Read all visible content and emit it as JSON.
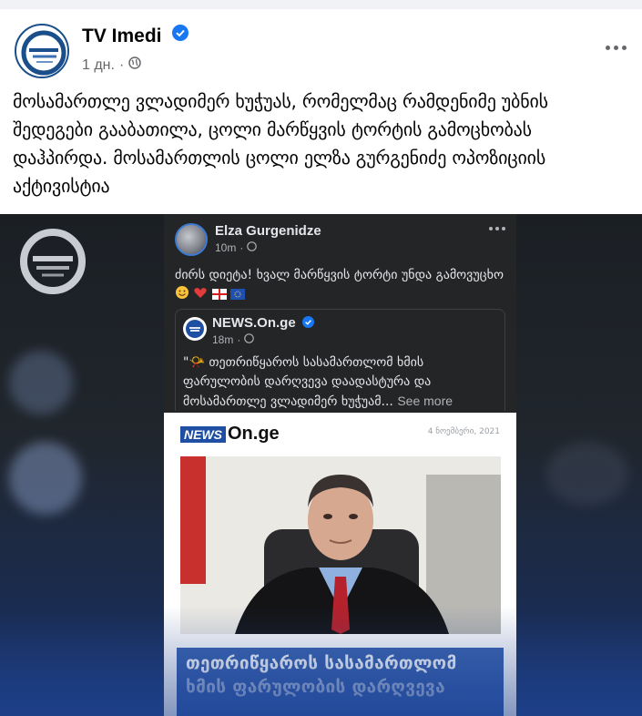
{
  "post": {
    "page_name": "TV Imedi",
    "time": "1 дн.",
    "separator": "·",
    "caption": "მოსამართლე ვლადიმერ ხუჭუას, რომელმაც რამდენიმე უბნის შედეგები გააბათილა, ცოლი მარწყვის ტორტის გამოცხობას დაჰპირდა. მოსამართლის ცოლი ელზა გურგენიძე ოპოზიციის აქტივისტია"
  },
  "screenshot": {
    "author": "Elza Gurgenidze",
    "time": "10m",
    "separator": "·",
    "text": "ძირს დიეტა! ხვალ მარწყვის ტორტი უნდა გამოვუცხო",
    "shared": {
      "source": "NEWS.On.ge",
      "time": "18m",
      "separator": "·",
      "text": "\"📯 თეთრიწყაროს სასამართლომ ხმის ფარულობის დარღვევა დაადასტურა და მოსამართლე ვლადიმერ ხუჭუამ...",
      "see_more": "See more"
    },
    "article": {
      "logo_news": "NEWS",
      "logo_on": "On.ge",
      "date": "4 ნოემბერი, 2021",
      "title_line1": "თეთრიწყაროს სასამართლომ",
      "title_line2": "ხმის ფარულობის დარღვევა"
    }
  },
  "colors": {
    "verified": "#1877f2",
    "brand_blue": "#1a4f8b",
    "card_bg": "#242526"
  },
  "icons": {
    "verified": "verified-badge-icon",
    "privacy": "globe-icon",
    "more": "more-dots-icon"
  }
}
